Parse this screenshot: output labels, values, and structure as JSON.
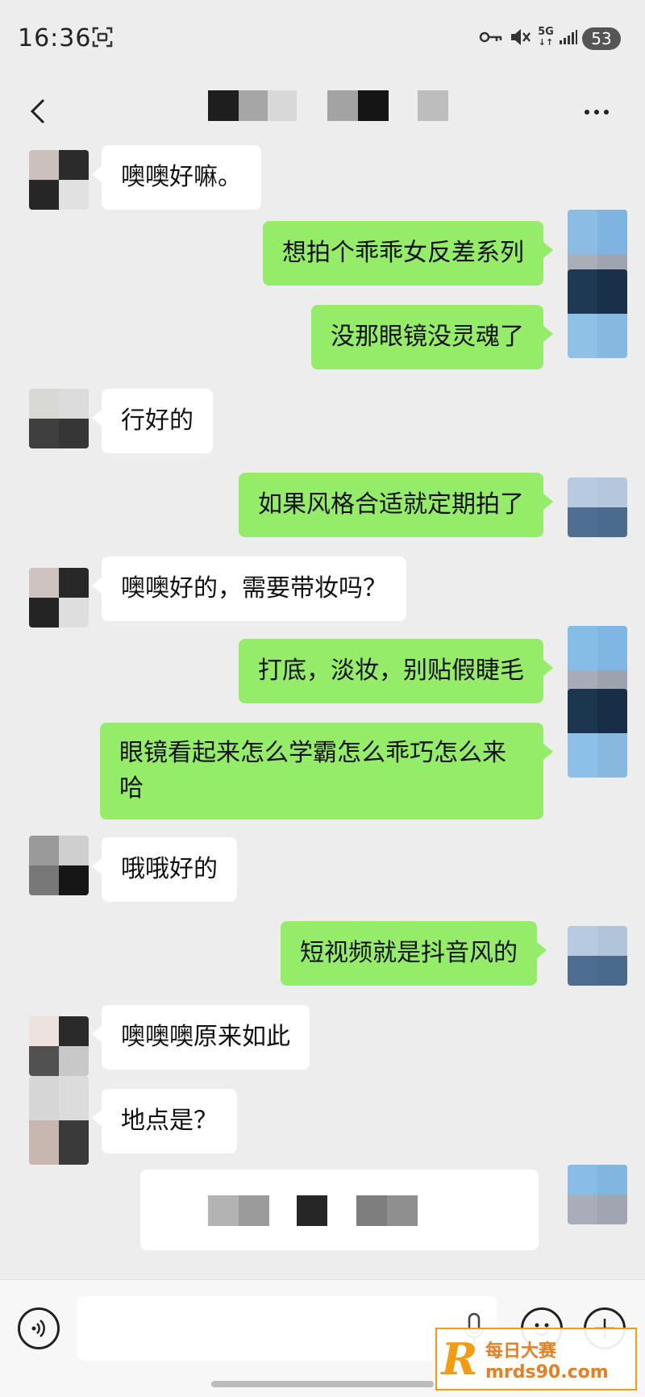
{
  "status": {
    "time": "16:36",
    "battery": "53",
    "network": "5G",
    "icons": [
      "screenshot-icon",
      "key-icon",
      "mute-icon",
      "network-5g-icon",
      "signal-icon"
    ]
  },
  "nav": {
    "title_redacted": true,
    "back_icon": "chevron-left-icon",
    "more_icon": "more-dots-icon"
  },
  "messages": [
    {
      "side": "left",
      "text": "噢噢好嘛。"
    },
    {
      "side": "right",
      "text": "想拍个乖乖女反差系列"
    },
    {
      "side": "right",
      "text": "没那眼镜没灵魂了"
    },
    {
      "side": "left",
      "text": "行好的"
    },
    {
      "side": "right",
      "text": "如果风格合适就定期拍了"
    },
    {
      "side": "left",
      "text": "噢噢好的，需要带妆吗？"
    },
    {
      "side": "right",
      "text": "打底，淡妆，别贴假睫毛"
    },
    {
      "side": "right",
      "text": "眼镜看起来怎么学霸怎么乖巧怎么来哈"
    },
    {
      "side": "left",
      "text": "哦哦好的"
    },
    {
      "side": "right",
      "text": "短视频就是抖音风的"
    },
    {
      "side": "left",
      "text": "噢噢噢原来如此"
    },
    {
      "side": "left",
      "text": "地点是？"
    },
    {
      "side": "right",
      "text": "",
      "redacted": true
    }
  ],
  "bottom": {
    "voice_icon": "voice-icon",
    "mic_icon": "mic-icon",
    "emoji_icon": "emoji-icon",
    "plus_icon": "plus-icon"
  },
  "watermark": {
    "logo": "R",
    "name": "每日大赛",
    "url": "mrds90.com"
  }
}
